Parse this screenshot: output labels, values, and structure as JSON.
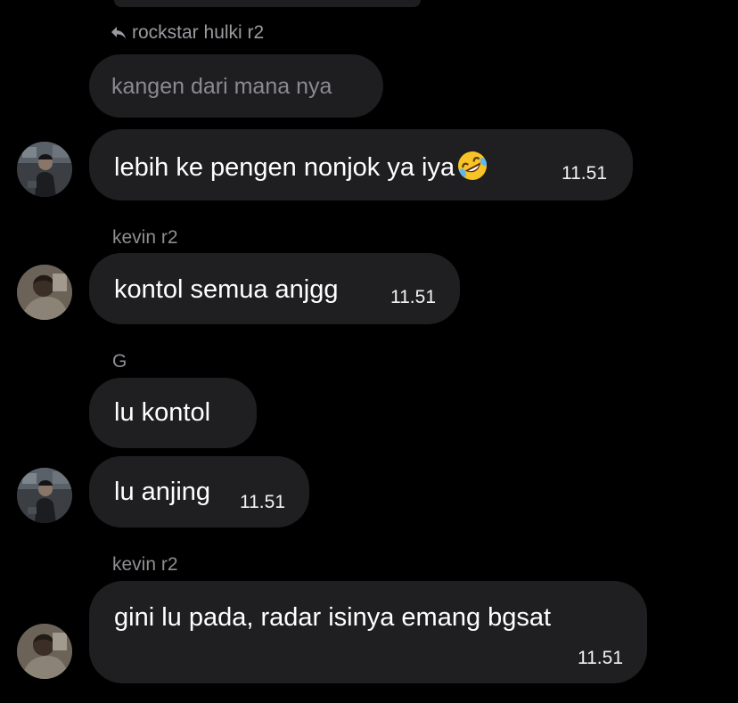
{
  "reply_to": {
    "icon": "reply-arrow-icon",
    "name": "rockstar hulki r2"
  },
  "messages": [
    {
      "quoted_text": "kangen dari mana nya"
    },
    {
      "text": "lebih ke pengen nonjok ya iya",
      "emoji": "rolling-on-floor-laughing-emoji",
      "time": "11.51"
    },
    {
      "sender": "kevin r2",
      "text": "kontol semua anjgg",
      "time": "11.51"
    },
    {
      "sender": "G",
      "text": "lu kontol"
    },
    {
      "text": "lu anjing",
      "time": "11.51"
    },
    {
      "sender": "kevin r2",
      "text": "gini lu pada, radar isinya emang bgsat",
      "time": "11.51"
    }
  ],
  "colors": {
    "background": "#000000",
    "bubble": "#1f1f21",
    "meta_text": "#8e8e93"
  }
}
